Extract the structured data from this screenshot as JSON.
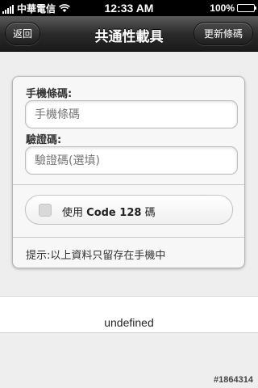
{
  "status_bar": {
    "carrier": "中華電信",
    "time": "12:33 AM",
    "battery": "100%"
  },
  "nav": {
    "title": "共通性載具",
    "back_label": "返回",
    "refresh_label": "更新條碼"
  },
  "form": {
    "phone_label": "手機條碼:",
    "phone_placeholder": "手機條碼",
    "verify_label": "驗證碼:",
    "verify_placeholder": "驗證碼(選填)",
    "checkbox_prefix": "使用",
    "checkbox_bold": "Code 128",
    "checkbox_suffix": "碼",
    "checkbox_checked": false,
    "hint": "提示:以上資料只留存在手機中"
  },
  "result": {
    "text": "undefined"
  },
  "watermark": "#1864314",
  "icons": {
    "signal": "signal-icon",
    "wifi": "wifi-icon",
    "battery": "battery-icon",
    "checkbox": "checkbox-icon"
  }
}
